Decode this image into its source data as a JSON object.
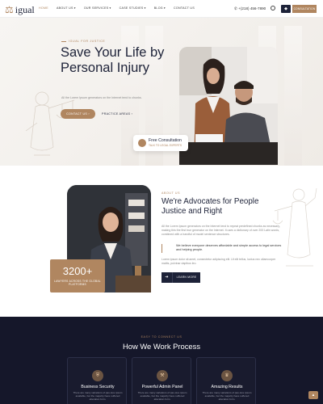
{
  "nav": {
    "logo": "igual",
    "items": [
      {
        "label": "HOME",
        "dropdown": false
      },
      {
        "label": "ABOUT US",
        "dropdown": true
      },
      {
        "label": "OUR SERVICES",
        "dropdown": true
      },
      {
        "label": "CASE STUDIES",
        "dropdown": true
      },
      {
        "label": "BLOG",
        "dropdown": true
      },
      {
        "label": "CONTACT US",
        "dropdown": false
      }
    ],
    "phone": "+(218) 456-7890",
    "cart_icon": "shopping-bag-icon",
    "cta_label": "CONSULTATION"
  },
  "hero": {
    "kicker": "IGUAL FOR JUSTICE",
    "title": "Save Your Life by Personal Injury",
    "description": "All the Lorem Ipsum generators on the Internet tend to chunks.",
    "primary_button": "CONTACT US",
    "secondary_button": "PRACTICE AREAS",
    "consult_title": "Free Consultation",
    "consult_subtitle": "TALK TO LEGAL EXPERTS"
  },
  "about": {
    "stat_number": "3200+",
    "stat_label": "LAWYERS ACROSS THE GLOBAL PLATFORMS",
    "kicker": "ABOUT US",
    "title": "We're Advocates for People Justice and Right",
    "paragraph1": "All the Lorem Ipsum generators on the Internet tend to repeat predefined chunks as necessary, making this the first true generator on the Internet. It uses a dictionary of over 200 Latin words, combined with a handful of model sentence structures.",
    "quote": "We believe everyone deserves affordable and simple access to legal services and helping people.",
    "paragraph2": "Lorem ipsum dolor sit amet, consectetur adipiscing elit. Ut elit tellus, luctus nec ullamcorper mattis, pulvinar dapibus leo.",
    "button_label": "LEARN MORE"
  },
  "work": {
    "kicker": "EASY TO CONNECT US",
    "title": "How We Work Process",
    "cards": [
      {
        "title": "Business Security",
        "icon": "shield-icon",
        "desc": "There are many variations of pas-sive ipsum available, but the majority have suffered alteration form."
      },
      {
        "title": "Powerful Admin Panel",
        "icon": "gavel-icon",
        "desc": "There are many variations of pas-sive ipsum available, but the majority have suffered alteration form."
      },
      {
        "title": "Amazing Results",
        "icon": "trophy-icon",
        "desc": "There are many variations of pas-sive ipsum available, but the majority have suffered alteration form."
      }
    ]
  },
  "colors": {
    "accent": "#b08660",
    "navy": "#1d2238",
    "dark_bg": "#15172a"
  }
}
